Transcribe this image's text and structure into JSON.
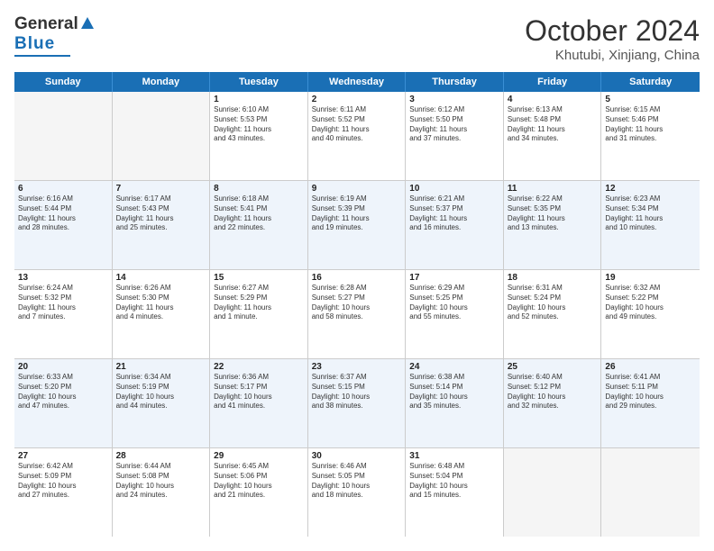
{
  "header": {
    "logo_text1": "General",
    "logo_text2": "Blue",
    "title": "October 2024",
    "subtitle": "Khutubi, Xinjiang, China"
  },
  "days_of_week": [
    "Sunday",
    "Monday",
    "Tuesday",
    "Wednesday",
    "Thursday",
    "Friday",
    "Saturday"
  ],
  "rows": [
    [
      {
        "day": "",
        "lines": []
      },
      {
        "day": "",
        "lines": []
      },
      {
        "day": "1",
        "lines": [
          "Sunrise: 6:10 AM",
          "Sunset: 5:53 PM",
          "Daylight: 11 hours",
          "and 43 minutes."
        ]
      },
      {
        "day": "2",
        "lines": [
          "Sunrise: 6:11 AM",
          "Sunset: 5:52 PM",
          "Daylight: 11 hours",
          "and 40 minutes."
        ]
      },
      {
        "day": "3",
        "lines": [
          "Sunrise: 6:12 AM",
          "Sunset: 5:50 PM",
          "Daylight: 11 hours",
          "and 37 minutes."
        ]
      },
      {
        "day": "4",
        "lines": [
          "Sunrise: 6:13 AM",
          "Sunset: 5:48 PM",
          "Daylight: 11 hours",
          "and 34 minutes."
        ]
      },
      {
        "day": "5",
        "lines": [
          "Sunrise: 6:15 AM",
          "Sunset: 5:46 PM",
          "Daylight: 11 hours",
          "and 31 minutes."
        ]
      }
    ],
    [
      {
        "day": "6",
        "lines": [
          "Sunrise: 6:16 AM",
          "Sunset: 5:44 PM",
          "Daylight: 11 hours",
          "and 28 minutes."
        ]
      },
      {
        "day": "7",
        "lines": [
          "Sunrise: 6:17 AM",
          "Sunset: 5:43 PM",
          "Daylight: 11 hours",
          "and 25 minutes."
        ]
      },
      {
        "day": "8",
        "lines": [
          "Sunrise: 6:18 AM",
          "Sunset: 5:41 PM",
          "Daylight: 11 hours",
          "and 22 minutes."
        ]
      },
      {
        "day": "9",
        "lines": [
          "Sunrise: 6:19 AM",
          "Sunset: 5:39 PM",
          "Daylight: 11 hours",
          "and 19 minutes."
        ]
      },
      {
        "day": "10",
        "lines": [
          "Sunrise: 6:21 AM",
          "Sunset: 5:37 PM",
          "Daylight: 11 hours",
          "and 16 minutes."
        ]
      },
      {
        "day": "11",
        "lines": [
          "Sunrise: 6:22 AM",
          "Sunset: 5:35 PM",
          "Daylight: 11 hours",
          "and 13 minutes."
        ]
      },
      {
        "day": "12",
        "lines": [
          "Sunrise: 6:23 AM",
          "Sunset: 5:34 PM",
          "Daylight: 11 hours",
          "and 10 minutes."
        ]
      }
    ],
    [
      {
        "day": "13",
        "lines": [
          "Sunrise: 6:24 AM",
          "Sunset: 5:32 PM",
          "Daylight: 11 hours",
          "and 7 minutes."
        ]
      },
      {
        "day": "14",
        "lines": [
          "Sunrise: 6:26 AM",
          "Sunset: 5:30 PM",
          "Daylight: 11 hours",
          "and 4 minutes."
        ]
      },
      {
        "day": "15",
        "lines": [
          "Sunrise: 6:27 AM",
          "Sunset: 5:29 PM",
          "Daylight: 11 hours",
          "and 1 minute."
        ]
      },
      {
        "day": "16",
        "lines": [
          "Sunrise: 6:28 AM",
          "Sunset: 5:27 PM",
          "Daylight: 10 hours",
          "and 58 minutes."
        ]
      },
      {
        "day": "17",
        "lines": [
          "Sunrise: 6:29 AM",
          "Sunset: 5:25 PM",
          "Daylight: 10 hours",
          "and 55 minutes."
        ]
      },
      {
        "day": "18",
        "lines": [
          "Sunrise: 6:31 AM",
          "Sunset: 5:24 PM",
          "Daylight: 10 hours",
          "and 52 minutes."
        ]
      },
      {
        "day": "19",
        "lines": [
          "Sunrise: 6:32 AM",
          "Sunset: 5:22 PM",
          "Daylight: 10 hours",
          "and 49 minutes."
        ]
      }
    ],
    [
      {
        "day": "20",
        "lines": [
          "Sunrise: 6:33 AM",
          "Sunset: 5:20 PM",
          "Daylight: 10 hours",
          "and 47 minutes."
        ]
      },
      {
        "day": "21",
        "lines": [
          "Sunrise: 6:34 AM",
          "Sunset: 5:19 PM",
          "Daylight: 10 hours",
          "and 44 minutes."
        ]
      },
      {
        "day": "22",
        "lines": [
          "Sunrise: 6:36 AM",
          "Sunset: 5:17 PM",
          "Daylight: 10 hours",
          "and 41 minutes."
        ]
      },
      {
        "day": "23",
        "lines": [
          "Sunrise: 6:37 AM",
          "Sunset: 5:15 PM",
          "Daylight: 10 hours",
          "and 38 minutes."
        ]
      },
      {
        "day": "24",
        "lines": [
          "Sunrise: 6:38 AM",
          "Sunset: 5:14 PM",
          "Daylight: 10 hours",
          "and 35 minutes."
        ]
      },
      {
        "day": "25",
        "lines": [
          "Sunrise: 6:40 AM",
          "Sunset: 5:12 PM",
          "Daylight: 10 hours",
          "and 32 minutes."
        ]
      },
      {
        "day": "26",
        "lines": [
          "Sunrise: 6:41 AM",
          "Sunset: 5:11 PM",
          "Daylight: 10 hours",
          "and 29 minutes."
        ]
      }
    ],
    [
      {
        "day": "27",
        "lines": [
          "Sunrise: 6:42 AM",
          "Sunset: 5:09 PM",
          "Daylight: 10 hours",
          "and 27 minutes."
        ]
      },
      {
        "day": "28",
        "lines": [
          "Sunrise: 6:44 AM",
          "Sunset: 5:08 PM",
          "Daylight: 10 hours",
          "and 24 minutes."
        ]
      },
      {
        "day": "29",
        "lines": [
          "Sunrise: 6:45 AM",
          "Sunset: 5:06 PM",
          "Daylight: 10 hours",
          "and 21 minutes."
        ]
      },
      {
        "day": "30",
        "lines": [
          "Sunrise: 6:46 AM",
          "Sunset: 5:05 PM",
          "Daylight: 10 hours",
          "and 18 minutes."
        ]
      },
      {
        "day": "31",
        "lines": [
          "Sunrise: 6:48 AM",
          "Sunset: 5:04 PM",
          "Daylight: 10 hours",
          "and 15 minutes."
        ]
      },
      {
        "day": "",
        "lines": []
      },
      {
        "day": "",
        "lines": []
      }
    ]
  ],
  "colors": {
    "header_bg": "#1a6fb5",
    "alt_row_bg": "#dce9f5",
    "empty_bg": "#f5f5f5",
    "white": "#ffffff"
  }
}
